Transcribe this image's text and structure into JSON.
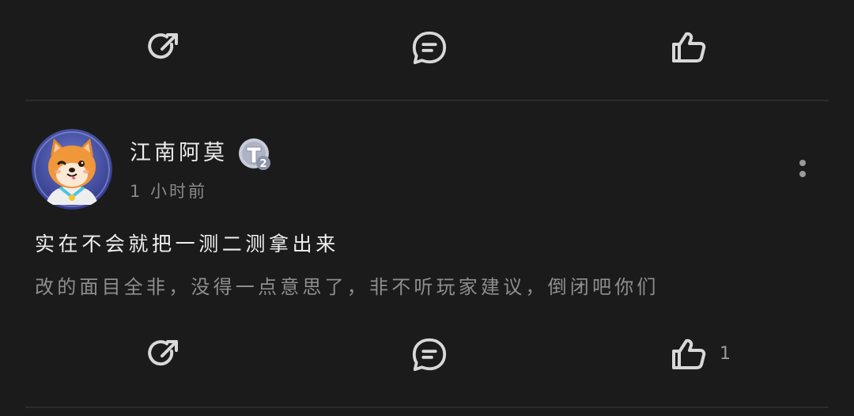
{
  "top_actions": {
    "share_icon": "share-icon",
    "comment_icon": "comment-icon",
    "like_icon": "thumbs-up-icon"
  },
  "post": {
    "author": {
      "name": "江南阿莫",
      "avatar_icon": "shiba-dog-avatar",
      "level_badge": "T2"
    },
    "time": "1 小时前",
    "title": "实在不会就把一测二测拿出来",
    "body": "改的面目全非，没得一点意思了，非不听玩家建议，倒闭吧你们",
    "actions": {
      "share_icon": "share-icon",
      "comment_icon": "comment-icon",
      "like_icon": "thumbs-up-icon",
      "like_count": "1"
    }
  },
  "colors": {
    "background": "#1b1b1b",
    "divider": "#2c2c2c",
    "icon": "#d8d8d8",
    "primary_text": "#f0f0f0",
    "secondary_text": "#8e8e8e"
  }
}
